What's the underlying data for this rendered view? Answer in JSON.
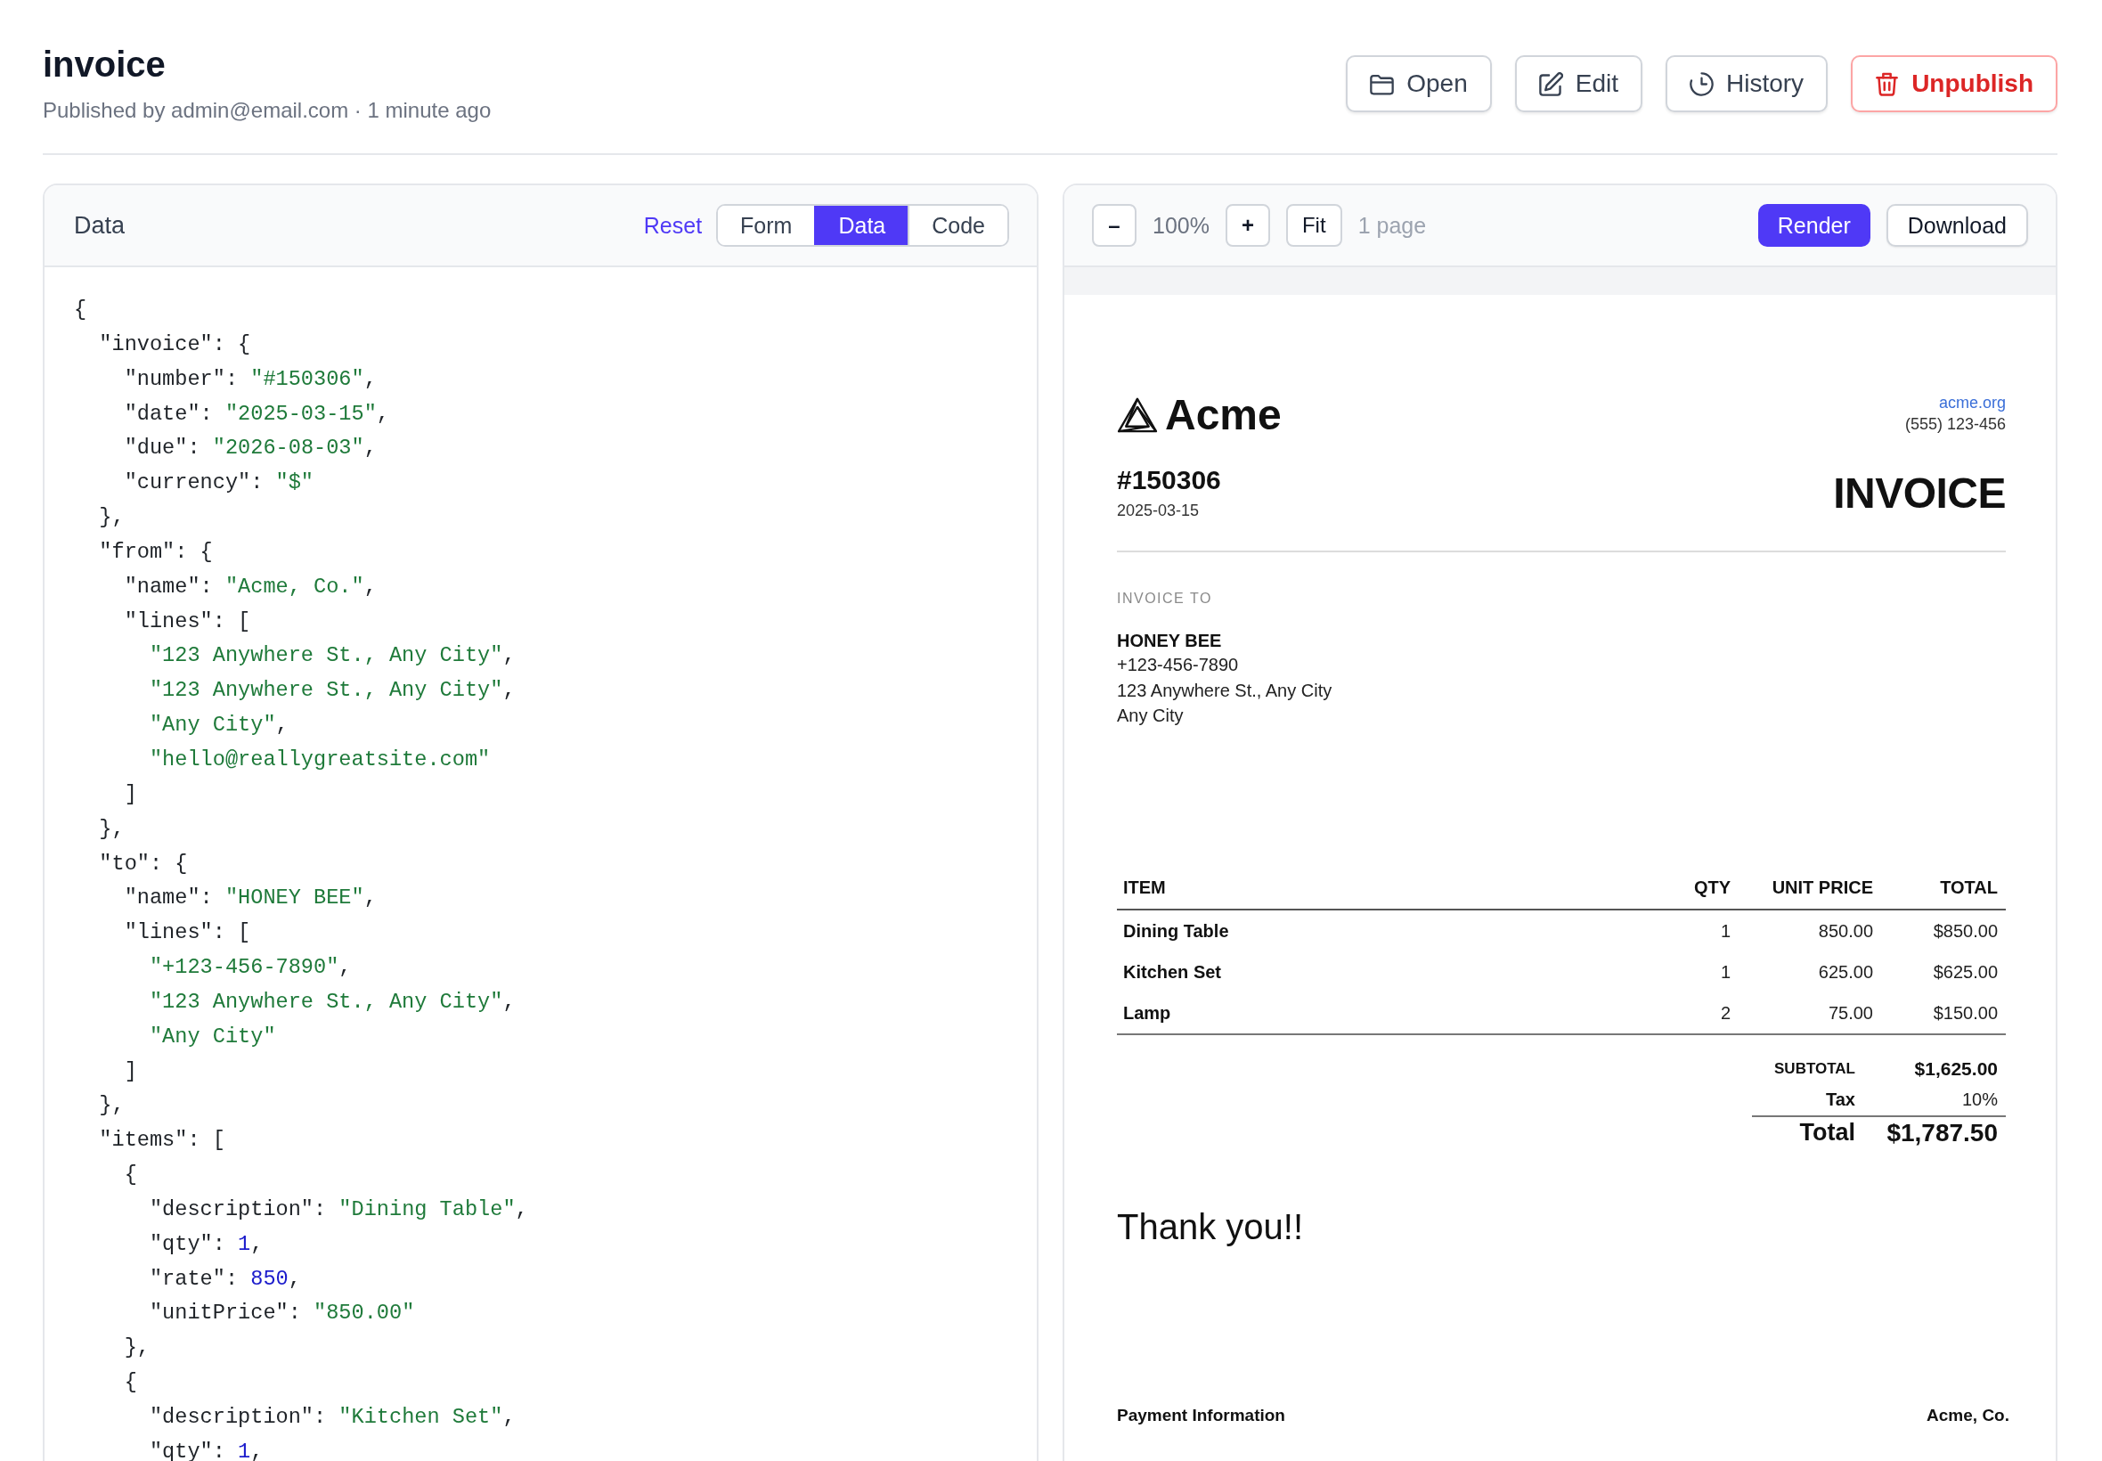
{
  "page": {
    "title": "invoice",
    "subtitle": "Published by admin@email.com · 1 minute ago"
  },
  "actions": [
    {
      "kind": "open",
      "label": "Open"
    },
    {
      "kind": "edit",
      "label": "Edit"
    },
    {
      "kind": "history",
      "label": "History"
    },
    {
      "kind": "unpublish",
      "label": "Unpublish"
    }
  ],
  "data_panel": {
    "title": "Data",
    "reset": "Reset",
    "modes": [
      {
        "label": "Form",
        "selected": false
      },
      {
        "label": "Data",
        "selected": true
      },
      {
        "label": "Code",
        "selected": false
      }
    ],
    "code_lines": [
      [
        {
          "kind": "plain",
          "text": "{"
        }
      ],
      [
        {
          "kind": "plain",
          "text": "  \"invoice\": {"
        }
      ],
      [
        {
          "kind": "plain",
          "text": "    \"number\": "
        },
        {
          "kind": "string",
          "text": "\"#150306\""
        },
        {
          "kind": "plain",
          "text": ","
        }
      ],
      [
        {
          "kind": "plain",
          "text": "    \"date\": "
        },
        {
          "kind": "string",
          "text": "\"2025-03-15\""
        },
        {
          "kind": "plain",
          "text": ","
        }
      ],
      [
        {
          "kind": "plain",
          "text": "    \"due\": "
        },
        {
          "kind": "string",
          "text": "\"2026-08-03\""
        },
        {
          "kind": "plain",
          "text": ","
        }
      ],
      [
        {
          "kind": "plain",
          "text": "    \"currency\": "
        },
        {
          "kind": "string",
          "text": "\"$\""
        }
      ],
      [
        {
          "kind": "plain",
          "text": "  },"
        }
      ],
      [
        {
          "kind": "plain",
          "text": "  \"from\": {"
        }
      ],
      [
        {
          "kind": "plain",
          "text": "    \"name\": "
        },
        {
          "kind": "string",
          "text": "\"Acme, Co.\""
        },
        {
          "kind": "plain",
          "text": ","
        }
      ],
      [
        {
          "kind": "plain",
          "text": "    \"lines\": ["
        }
      ],
      [
        {
          "kind": "string",
          "text": "      \"123 Anywhere St., Any City\""
        },
        {
          "kind": "plain",
          "text": ","
        }
      ],
      [
        {
          "kind": "string",
          "text": "      \"123 Anywhere St., Any City\""
        },
        {
          "kind": "plain",
          "text": ","
        }
      ],
      [
        {
          "kind": "string",
          "text": "      \"Any City\""
        },
        {
          "kind": "plain",
          "text": ","
        }
      ],
      [
        {
          "kind": "string",
          "text": "      \"hello@reallygreatsite.com\""
        }
      ],
      [
        {
          "kind": "plain",
          "text": "    ]"
        }
      ],
      [
        {
          "kind": "plain",
          "text": "  },"
        }
      ],
      [
        {
          "kind": "plain",
          "text": "  \"to\": {"
        }
      ],
      [
        {
          "kind": "plain",
          "text": "    \"name\": "
        },
        {
          "kind": "string",
          "text": "\"HONEY BEE\""
        },
        {
          "kind": "plain",
          "text": ","
        }
      ],
      [
        {
          "kind": "plain",
          "text": "    \"lines\": ["
        }
      ],
      [
        {
          "kind": "string",
          "text": "      \"+123-456-7890\""
        },
        {
          "kind": "plain",
          "text": ","
        }
      ],
      [
        {
          "kind": "string",
          "text": "      \"123 Anywhere St., Any City\""
        },
        {
          "kind": "plain",
          "text": ","
        }
      ],
      [
        {
          "kind": "string",
          "text": "      \"Any City\""
        }
      ],
      [
        {
          "kind": "plain",
          "text": "    ]"
        }
      ],
      [
        {
          "kind": "plain",
          "text": "  },"
        }
      ],
      [
        {
          "kind": "plain",
          "text": "  \"items\": ["
        }
      ],
      [
        {
          "kind": "plain",
          "text": "    {"
        }
      ],
      [
        {
          "kind": "plain",
          "text": "      \"description\": "
        },
        {
          "kind": "string",
          "text": "\"Dining Table\""
        },
        {
          "kind": "plain",
          "text": ","
        }
      ],
      [
        {
          "kind": "plain",
          "text": "      \"qty\": "
        },
        {
          "kind": "number",
          "text": "1"
        },
        {
          "kind": "plain",
          "text": ","
        }
      ],
      [
        {
          "kind": "plain",
          "text": "      \"rate\": "
        },
        {
          "kind": "number",
          "text": "850"
        },
        {
          "kind": "plain",
          "text": ","
        }
      ],
      [
        {
          "kind": "plain",
          "text": "      \"unitPrice\": "
        },
        {
          "kind": "string",
          "text": "\"850.00\""
        }
      ],
      [
        {
          "kind": "plain",
          "text": "    },"
        }
      ],
      [
        {
          "kind": "plain",
          "text": "    {"
        }
      ],
      [
        {
          "kind": "plain",
          "text": "      \"description\": "
        },
        {
          "kind": "string",
          "text": "\"Kitchen Set\""
        },
        {
          "kind": "plain",
          "text": ","
        }
      ],
      [
        {
          "kind": "plain",
          "text": "      \"qty\": "
        },
        {
          "kind": "number",
          "text": "1"
        },
        {
          "kind": "plain",
          "text": ","
        }
      ]
    ]
  },
  "preview_panel": {
    "toolbar": {
      "zoom_out": "–",
      "zoom": "100%",
      "zoom_in": "+",
      "fit": "Fit",
      "pages": "1 page",
      "render": "Render",
      "download": "Download"
    },
    "document": {
      "brand": "Acme",
      "website": "acme.org",
      "phone": "(555) 123-456",
      "number": "#150306",
      "date": "2025-03-15",
      "doc_title": "INVOICE",
      "to_label": "INVOICE TO",
      "to_name": "HONEY BEE",
      "to_lines": [
        "+123-456-7890",
        "123 Anywhere St., Any City",
        "Any City"
      ],
      "table": {
        "columns": [
          "ITEM",
          "QTY",
          "UNIT PRICE",
          "TOTAL"
        ],
        "rows": [
          [
            "Dining Table",
            "1",
            "850.00",
            "$850.00"
          ],
          [
            "Kitchen Set",
            "1",
            "625.00",
            "$625.00"
          ],
          [
            "Lamp",
            "2",
            "75.00",
            "$150.00"
          ]
        ]
      },
      "totals": [
        {
          "kind": "subtotal",
          "label": "SUBTOTAL",
          "value": "$1,625.00"
        },
        {
          "kind": "tax",
          "label": "Tax",
          "value": "10%"
        },
        {
          "kind": "total",
          "label": "Total",
          "value": "$1,787.50"
        }
      ],
      "thanks": "Thank you!!",
      "payment_label": "Payment Information",
      "payment_name": "Acme, Co."
    }
  }
}
